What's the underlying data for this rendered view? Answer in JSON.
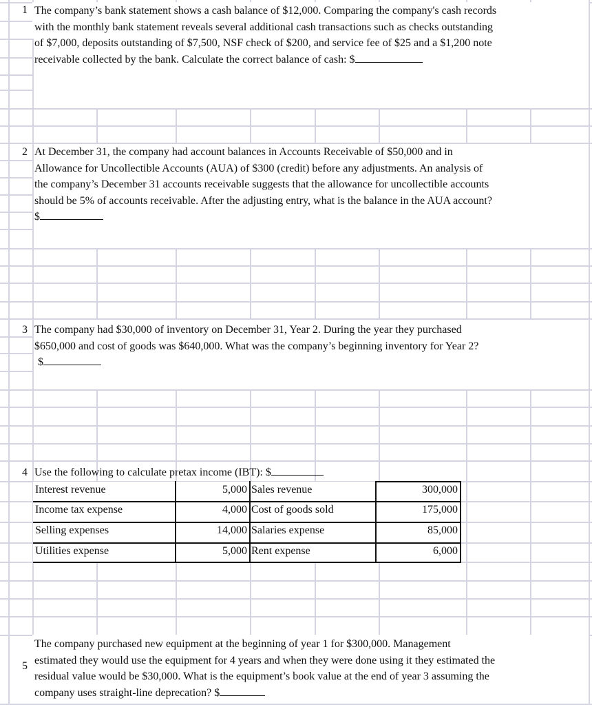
{
  "questions": [
    {
      "number": "1",
      "lines": [
        "The company’s bank statement shows a cash balance of $12,000. Comparing the company's cash records",
        "with the monthly bank statement reveals several additional cash transactions such as checks outstanding",
        "of $7,000, deposits outstanding of $7,500, NSF check of $200, and service fee of $25 and a $1,200 note",
        "receivable collected by the bank. Calculate the correct balance of cash: $"
      ]
    },
    {
      "number": "2",
      "lines": [
        "At December 31, the company had account balances in Accounts Receivable of $50,000 and in",
        "Allowance for Uncollectible Accounts (AUA) of $300 (credit) before any adjustments. An analysis of",
        "the company’s December 31 accounts receivable suggests that the allowance for uncollectible accounts",
        "should be 5% of accounts receivable.  After the adjusting entry, what is the balance in the AUA account?",
        "$"
      ]
    },
    {
      "number": "3",
      "lines": [
        "The company had $30,000 of inventory on December 31, Year 2.   During the year they purchased",
        "$650,000 and cost of goods was $640,000. What was the company’s beginning inventory for Year 2?",
        "$"
      ]
    },
    {
      "number": "4",
      "lines": [
        "Use the following to calculate pretax income (IBT): $"
      ],
      "table": {
        "left": [
          {
            "label": "Interest revenue",
            "value": "5,000"
          },
          {
            "label": "Income tax expense",
            "value": "4,000"
          },
          {
            "label": "Selling expenses",
            "value": "14,000"
          },
          {
            "label": "Utilities expense",
            "value": "5,000"
          }
        ],
        "right": [
          {
            "label": "Sales revenue",
            "value": "300,000"
          },
          {
            "label": "Cost of goods sold",
            "value": "175,000"
          },
          {
            "label": "Salaries expense",
            "value": "85,000"
          },
          {
            "label": "Rent expense",
            "value": "6,000"
          }
        ]
      }
    },
    {
      "number": "5",
      "lines": [
        "The company purchased new equipment at the beginning of year 1 for $300,000.  Management",
        "estimated they would use the equipment for 4 years and when they were done using it they estimated the",
        "residual value would be $30,000.  What is the equipment’s book value at the end of year 3 assuming the",
        "company uses straight-line deprecation? $"
      ]
    }
  ],
  "colors": {
    "gridline": "#d4d4e2",
    "text": "#111111",
    "table_border": "#111111"
  }
}
